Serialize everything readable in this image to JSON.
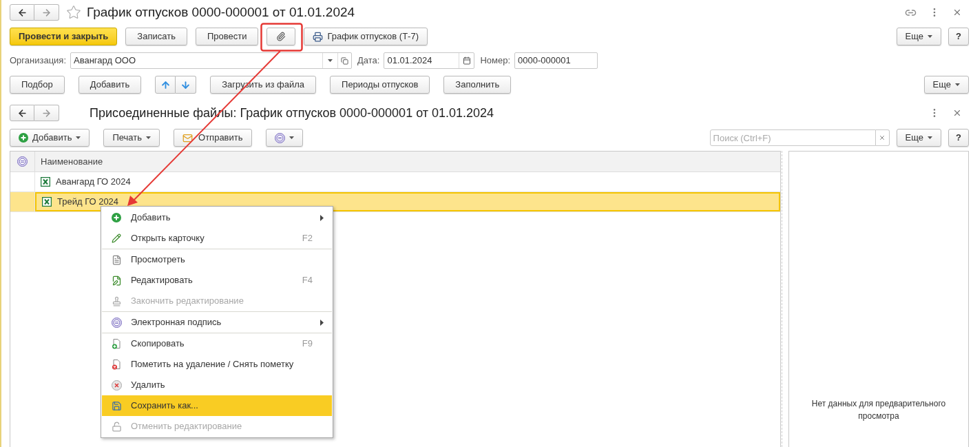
{
  "window": {
    "title": "График отпусков 0000-000001 от 01.01.2024",
    "favorite": false
  },
  "toolbar": {
    "buttons": [
      {
        "kind": "primary",
        "label": "Провести и закрыть"
      },
      {
        "kind": "plain",
        "label": "Записать"
      },
      {
        "kind": "plain",
        "label": "Провести"
      },
      {
        "kind": "attach"
      },
      {
        "kind": "print",
        "label": "График отпусков (Т-7)"
      }
    ],
    "more": "Еще",
    "help": "?"
  },
  "fields": [
    {
      "kind": "select",
      "label": "Организация:",
      "value": "Авангард ООО"
    },
    {
      "kind": "date",
      "label": "Дата:",
      "value": "01.01.2024"
    },
    {
      "kind": "text",
      "label": "Номер:",
      "value": "0000-000001"
    }
  ],
  "table_toolbar": {
    "buttons": [
      {
        "kind": "plain",
        "label": "Подбор"
      },
      {
        "kind": "plain",
        "label": "Добавить"
      },
      {
        "kind": "move"
      },
      {
        "kind": "plain",
        "label": "Загрузить из файла"
      },
      {
        "kind": "plain",
        "label": "Периоды отпусков"
      },
      {
        "kind": "plain",
        "label": "Заполнить"
      }
    ],
    "more": "Еще"
  },
  "attachments": {
    "title": "Присоединенные файлы: График отпусков 0000-000001 от 01.01.2024",
    "toolbar": {
      "buttons": [
        {
          "kind": "add",
          "label": "Добавить"
        },
        {
          "kind": "menu",
          "label": "Печать"
        },
        {
          "kind": "mail",
          "label": "Отправить"
        },
        {
          "kind": "signature"
        }
      ]
    },
    "search": {
      "placeholder": "Поиск (Ctrl+F)"
    },
    "more": "Еще",
    "help": "?",
    "table": {
      "columns": [
        "Наименование"
      ],
      "rows": [
        {
          "name": "Авангард ГО 2024",
          "selected": false
        },
        {
          "name": "Трейд ГО 2024",
          "selected": true
        }
      ]
    },
    "preview": {
      "message": "Нет данных для предварительного просмотра"
    }
  },
  "context_menu": {
    "groups": [
      [
        {
          "label": "Добавить",
          "submenu": true,
          "disabled": false,
          "selected": false
        },
        {
          "label": "Открыть карточку",
          "shortcut": "F2",
          "submenu": false,
          "disabled": false,
          "selected": false
        }
      ],
      [
        {
          "label": "Просмотреть",
          "submenu": false,
          "disabled": false,
          "selected": false
        },
        {
          "label": "Редактировать",
          "shortcut": "F4",
          "submenu": false,
          "disabled": false,
          "selected": false
        },
        {
          "label": "Закончить редактирование",
          "submenu": false,
          "disabled": true,
          "selected": false
        }
      ],
      [
        {
          "label": "Электронная подпись",
          "submenu": true,
          "disabled": false,
          "selected": false
        }
      ],
      [
        {
          "label": "Скопировать",
          "shortcut": "F9",
          "submenu": false,
          "disabled": false,
          "selected": false
        },
        {
          "label": "Пометить на удаление / Снять пометку",
          "submenu": false,
          "disabled": false,
          "selected": false
        },
        {
          "label": "Удалить",
          "submenu": false,
          "disabled": false,
          "selected": false
        },
        {
          "label": "Сохранить как...",
          "submenu": false,
          "disabled": false,
          "selected": true
        },
        {
          "label": "Отменить редактирование",
          "submenu": false,
          "disabled": true,
          "selected": false
        }
      ]
    ]
  }
}
